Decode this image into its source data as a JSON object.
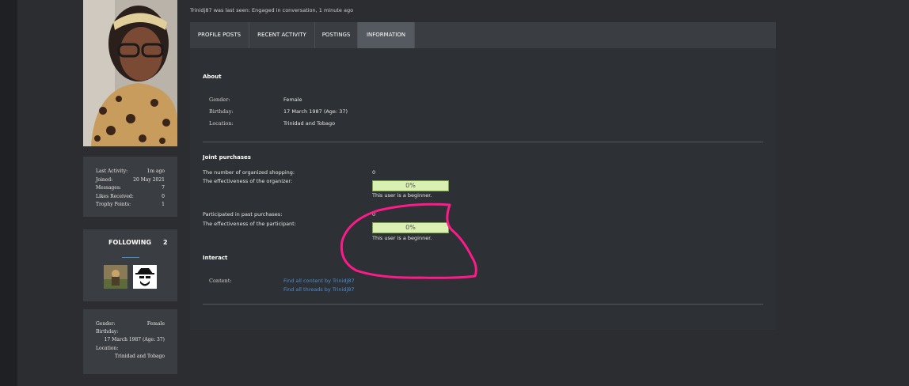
{
  "last_seen": "Trinidj87 was last seen: Engaged in conversation, 1 minute ago",
  "tabs": [
    {
      "label": "PROFILE POSTS"
    },
    {
      "label": "RECENT ACTIVITY"
    },
    {
      "label": "POSTINGS"
    },
    {
      "label": "INFORMATION",
      "active": true
    }
  ],
  "stats": [
    {
      "label": "Last Activity:",
      "value": "1m ago"
    },
    {
      "label": "Joined:",
      "value": "20 May 2021"
    },
    {
      "label": "Messages:",
      "value": "7"
    },
    {
      "label": "Likes Received:",
      "value": "0"
    },
    {
      "label": "Trophy Points:",
      "value": "1"
    }
  ],
  "following": {
    "title": "FOLLOWING",
    "count": "2"
  },
  "sidebar_info": {
    "gender_label": "Gender:",
    "gender_value": "Female",
    "birthday_label": "Birthday:",
    "birthday_value": "17 March 1987 (Age: 37)",
    "location_label": "Location:",
    "location_value": "Trinidad and Tobago"
  },
  "about": {
    "title": "About",
    "gender_label": "Gender:",
    "gender_value": "Female",
    "birthday_label": "Birthday:",
    "birthday_value": "17 March 1987 (Age: 37)",
    "location_label": "Location:",
    "location_value": "Trinidad and Tobago"
  },
  "joint": {
    "title": "Joint purchases",
    "organized_label": "The number of organized shopping:",
    "organized_value": "0",
    "org_eff_label": "The effectiveness of the organizer:",
    "org_eff_value": "0%",
    "org_eff_note": "This user is a beginner.",
    "participated_label": "Participated in past purchases:",
    "participated_value": "0",
    "part_eff_label": "The effectiveness of the participant:",
    "part_eff_value": "0%",
    "part_eff_note": "This user is a beginner."
  },
  "interact": {
    "title": "Interact",
    "content_label": "Content:",
    "link_content": "Find all content by Trinidj87",
    "link_threads": "Find all threads by Trinidj87"
  },
  "colors": {
    "accent": "#3a8fd6",
    "annotation": "#ff1a8c",
    "bar_fill": "#d9f0b2"
  },
  "annotation": "pink-freehand-circle"
}
